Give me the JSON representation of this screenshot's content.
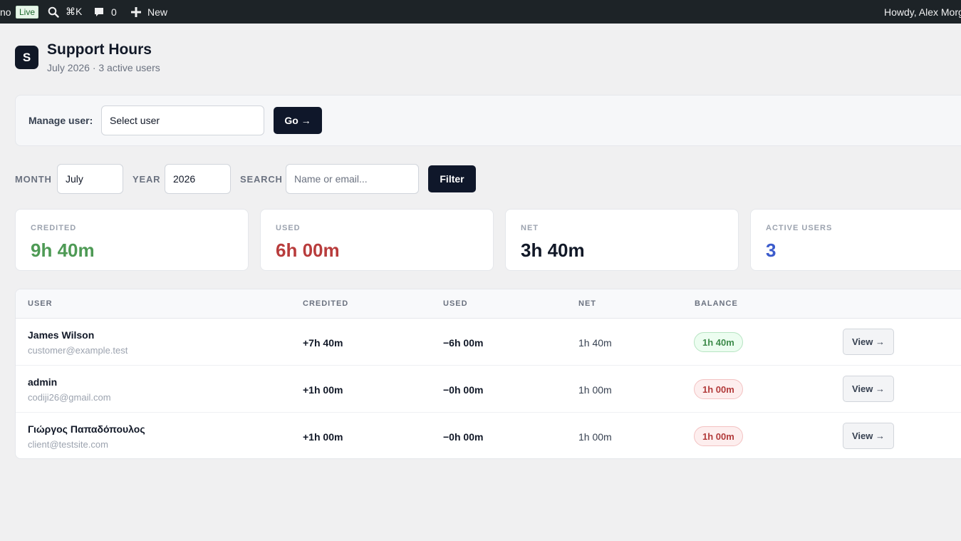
{
  "adminbar": {
    "site_fragment": "no",
    "live_badge": "Live",
    "search_shortcut": "⌘K",
    "comments_count": "0",
    "new_label": "New",
    "greeting": "Howdy, Alex Morg"
  },
  "header": {
    "logo_letter": "S",
    "title": "Support Hours",
    "subtitle": "July 2026 · 3 active users"
  },
  "manage": {
    "label": "Manage user:",
    "select_value": "Select user",
    "go_label": "Go →"
  },
  "filters": {
    "month_label": "MONTH",
    "month_value": "July",
    "year_label": "YEAR",
    "year_value": "2026",
    "search_label": "SEARCH",
    "search_placeholder": "Name or email...",
    "filter_label": "Filter"
  },
  "stats": [
    {
      "label": "CREDITED",
      "value": "9h 40m",
      "color": "#4e9a55"
    },
    {
      "label": "USED",
      "value": "6h 00m",
      "color": "#b83c3c"
    },
    {
      "label": "NET",
      "value": "3h 40m",
      "color": "#111827"
    },
    {
      "label": "ACTIVE USERS",
      "value": "3",
      "color": "#3b5bcc"
    }
  ],
  "table": {
    "columns": [
      "USER",
      "CREDITED",
      "USED",
      "NET",
      "BALANCE"
    ],
    "rows": [
      {
        "name": "James Wilson",
        "email": "customer@example.test",
        "credited": "+7h 40m",
        "used": "−6h 00m",
        "net": "1h 40m",
        "balance": "1h 40m",
        "balance_status": "positive",
        "action": "View →"
      },
      {
        "name": "admin",
        "email": "codiji26@gmail.com",
        "credited": "+1h 00m",
        "used": "−0h 00m",
        "net": "1h 00m",
        "balance": "1h 00m",
        "balance_status": "negative",
        "action": "View →"
      },
      {
        "name": "Γιώργος Παπαδόπουλος",
        "email": "client@testsite.com",
        "credited": "+1h 00m",
        "used": "−0h 00m",
        "net": "1h 00m",
        "balance": "1h 00m",
        "balance_status": "negative",
        "action": "View →"
      }
    ]
  }
}
